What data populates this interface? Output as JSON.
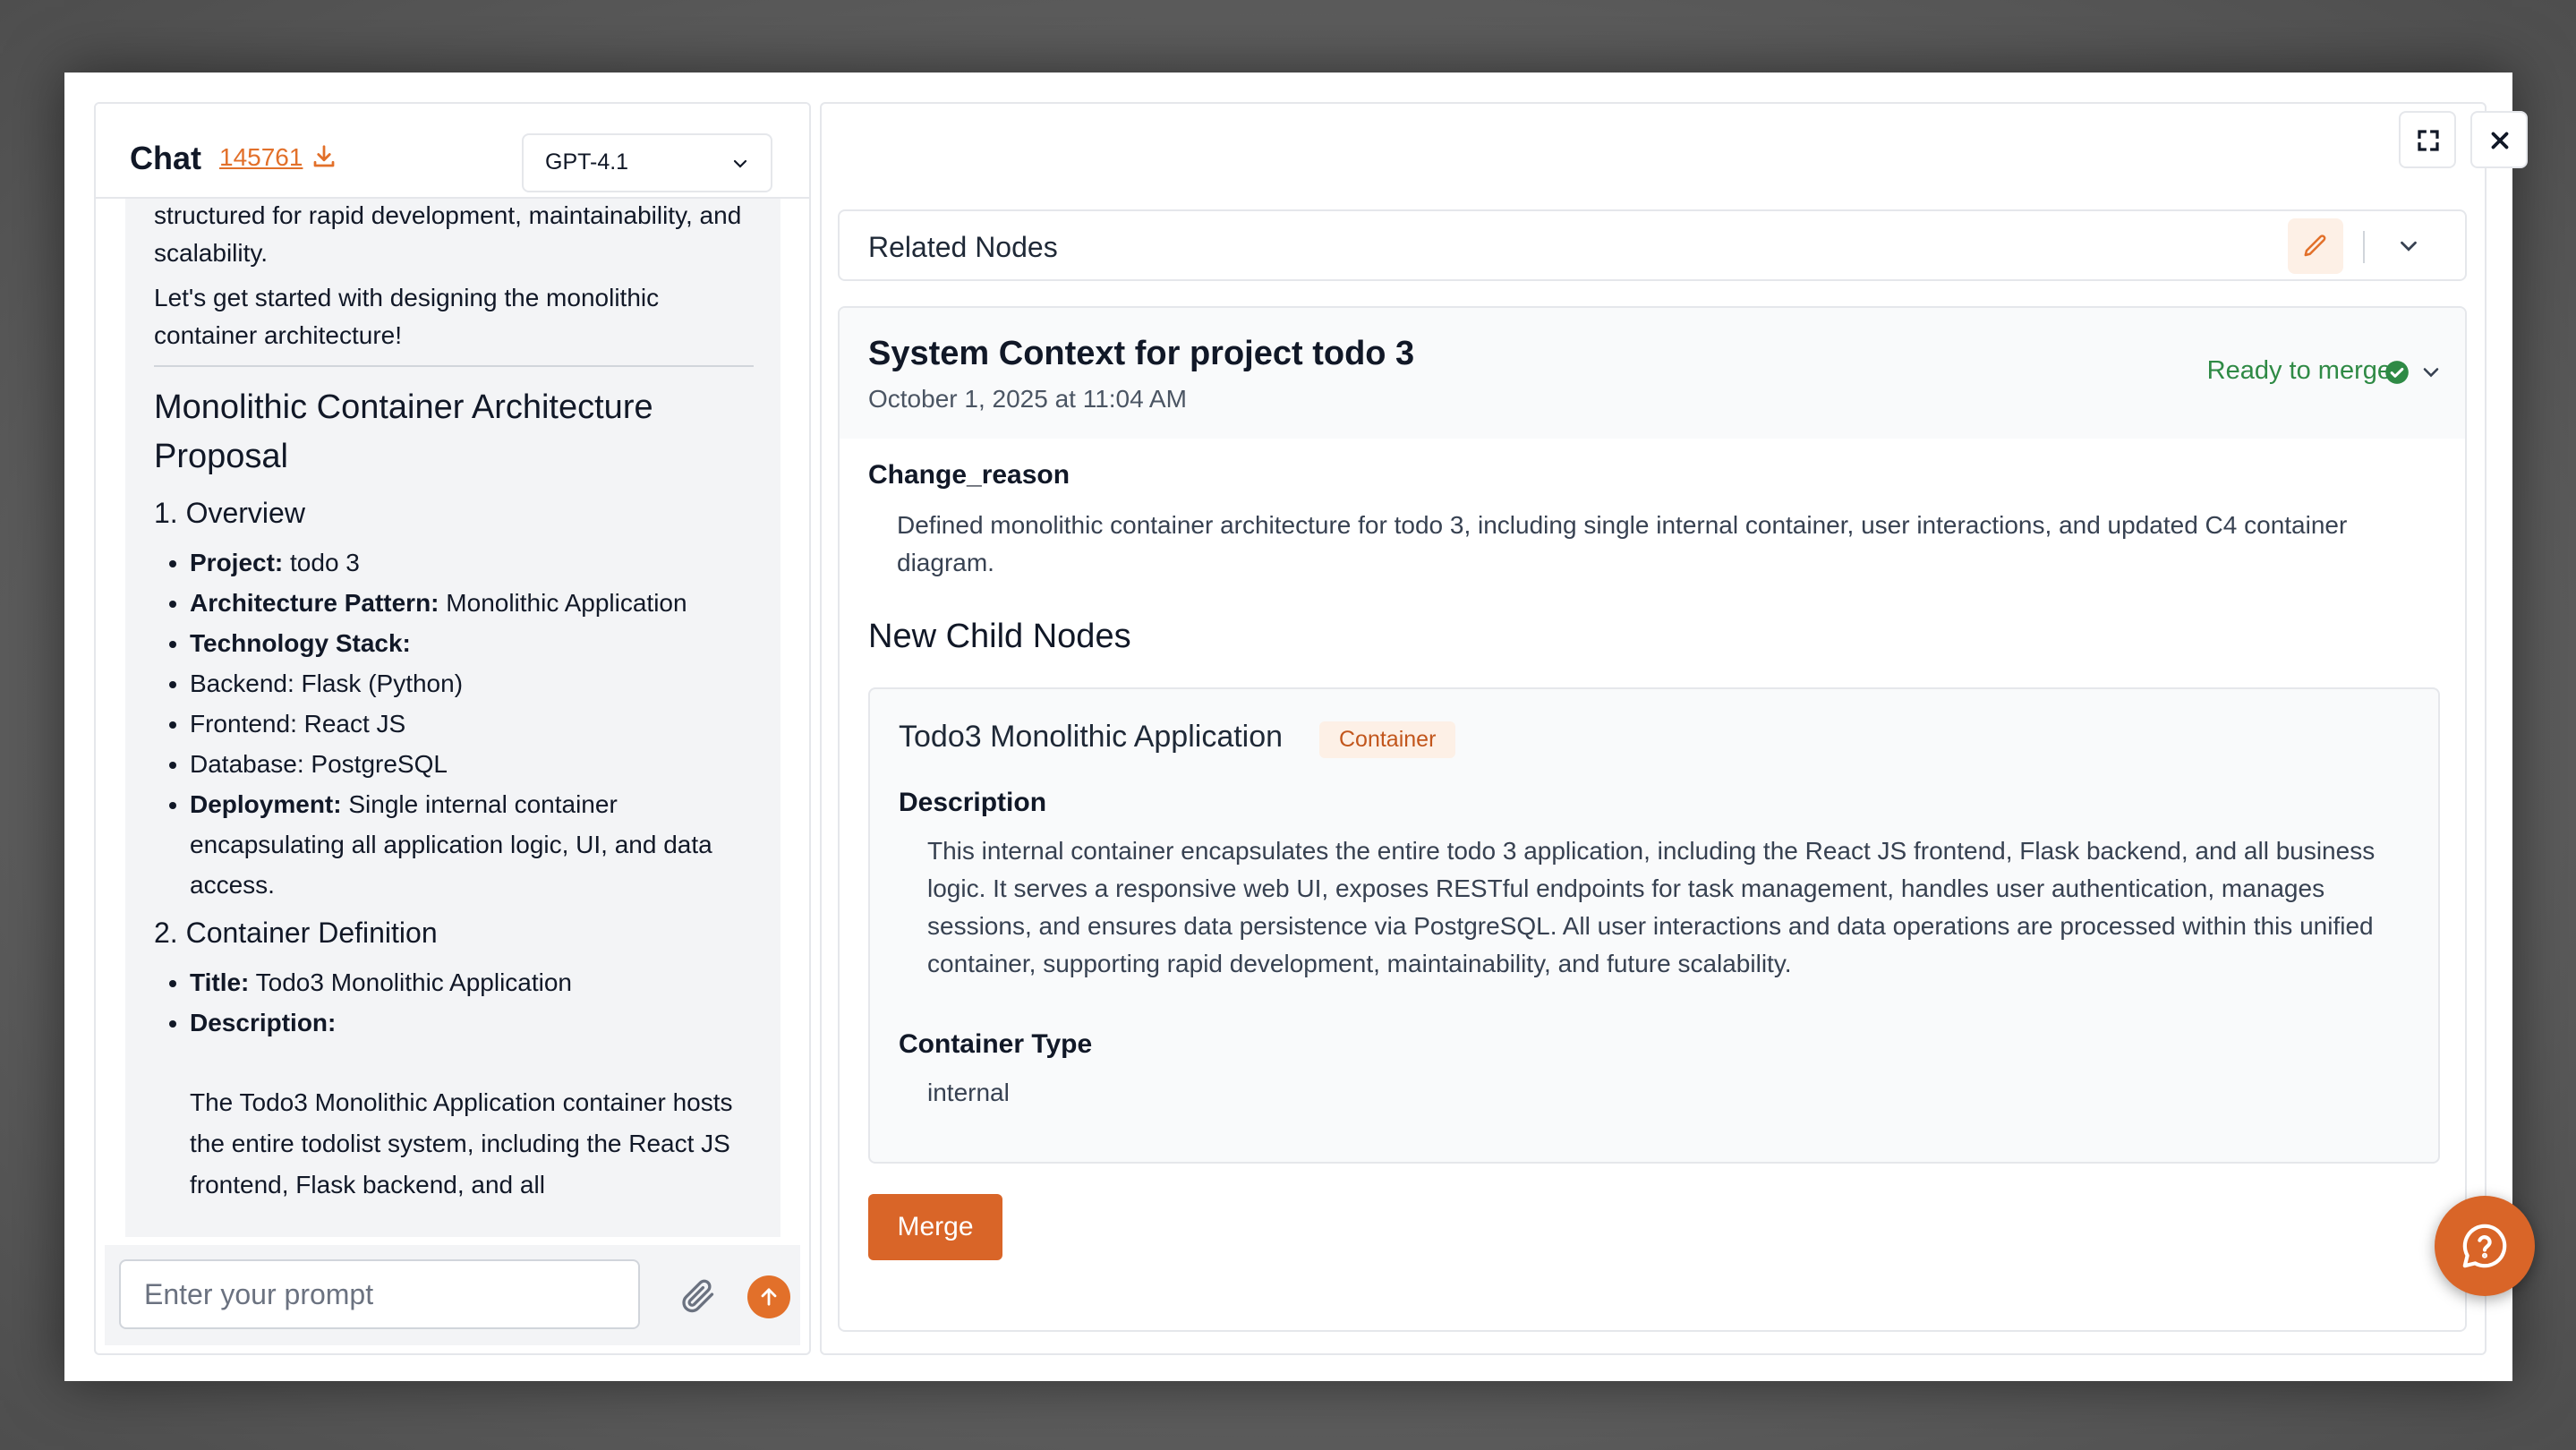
{
  "chat": {
    "title": "Chat",
    "id_link": "145761",
    "model": "GPT-4.1",
    "prompt_placeholder": "Enter your prompt",
    "messages": {
      "p1": "structured for rapid development, maintainability, and scalability.",
      "p2": "Let's get started with designing the monolithic container architecture!",
      "heading": "Monolithic Container Architecture Proposal",
      "overview_heading": "1. Overview",
      "overview_items": [
        {
          "label": "Project:",
          "value": " todo 3"
        },
        {
          "label": "Architecture Pattern:",
          "value": " Monolithic Application"
        },
        {
          "label": "Technology Stack:",
          "value": ""
        },
        {
          "label": "",
          "value": "Backend: Flask (Python)"
        },
        {
          "label": "",
          "value": "Frontend: React JS"
        },
        {
          "label": "",
          "value": "Database: PostgreSQL"
        },
        {
          "label": "Deployment:",
          "value": " Single internal container encapsulating all application logic, UI, and data access."
        }
      ],
      "container_heading": "2. Container Definition",
      "container_items": [
        {
          "label": "Title:",
          "value": " Todo3 Monolithic Application"
        },
        {
          "label": "Description:",
          "value": ""
        }
      ],
      "description_text": "The Todo3 Monolithic Application container hosts the entire todolist system, including the React JS frontend, Flask backend, and all"
    }
  },
  "related": {
    "title": "Related Nodes"
  },
  "card": {
    "title": "System Context for project todo 3",
    "date": "October 1, 2025 at 11:04 AM",
    "status": "Ready to merge",
    "status_color": "#2f8a45",
    "change_reason_label": "Change_reason",
    "change_reason": "Defined monolithic container architecture for todo 3, including single internal container, user interactions, and updated C4 container diagram.",
    "new_child_nodes_label": "New Child Nodes",
    "child": {
      "name": "Todo3 Monolithic Application",
      "badge": "Container",
      "description_label": "Description",
      "description": "This internal container encapsulates the entire todo 3 application, including the React JS frontend, Flask backend, and all business logic. It serves a responsive web UI, exposes RESTful endpoints for task management, handles user authentication, manages sessions, and ensures data persistence via PostgreSQL. All user interactions and data operations are processed within this unified container, supporting rapid development, maintainability, and future scalability.",
      "container_type_label": "Container Type",
      "container_type": "internal"
    },
    "merge_label": "Merge"
  },
  "colors": {
    "accent": "#e2702a",
    "button": "#d96528"
  }
}
